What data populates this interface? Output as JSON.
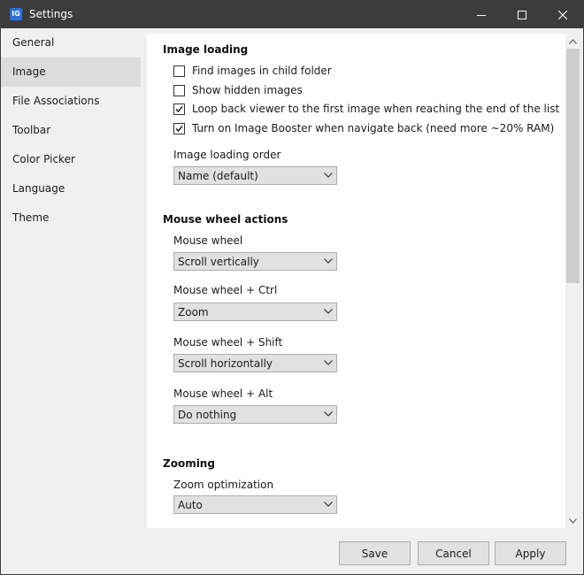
{
  "window": {
    "title": "Settings",
    "app_icon_text": "IG"
  },
  "sidebar": {
    "items": [
      {
        "label": "General"
      },
      {
        "label": "Image"
      },
      {
        "label": "File Associations"
      },
      {
        "label": "Toolbar"
      },
      {
        "label": "Color Picker"
      },
      {
        "label": "Language"
      },
      {
        "label": "Theme"
      }
    ],
    "active": "Image"
  },
  "image_loading": {
    "title": "Image loading",
    "options": [
      {
        "label": "Find images in child folder",
        "checked": false
      },
      {
        "label": "Show hidden images",
        "checked": false
      },
      {
        "label": "Loop back viewer to the first image when reaching the end of the list",
        "checked": true
      },
      {
        "label": "Turn on Image Booster when navigate back (need more ~20% RAM)",
        "checked": true
      }
    ],
    "order_label": "Image loading order",
    "order_value": "Name (default)"
  },
  "mouse_wheel": {
    "title": "Mouse wheel actions",
    "wheel_label": "Mouse wheel",
    "wheel_value": "Scroll vertically",
    "ctrl_label": "Mouse wheel + Ctrl",
    "ctrl_value": "Zoom",
    "shift_label": "Mouse wheel + Shift",
    "shift_value": "Scroll horizontally",
    "alt_label": "Mouse wheel + Alt",
    "alt_value": "Do nothing"
  },
  "zooming": {
    "title": "Zooming",
    "optimization_label": "Zoom optimization",
    "optimization_value": "Auto"
  },
  "footer": {
    "save": "Save",
    "cancel": "Cancel",
    "apply": "Apply"
  },
  "colors": {
    "titlebar": "#3c3c3c",
    "sidebar_active": "#dcdcdc",
    "content_bg": "#ffffff",
    "button_bg": "#e1e1e1"
  }
}
